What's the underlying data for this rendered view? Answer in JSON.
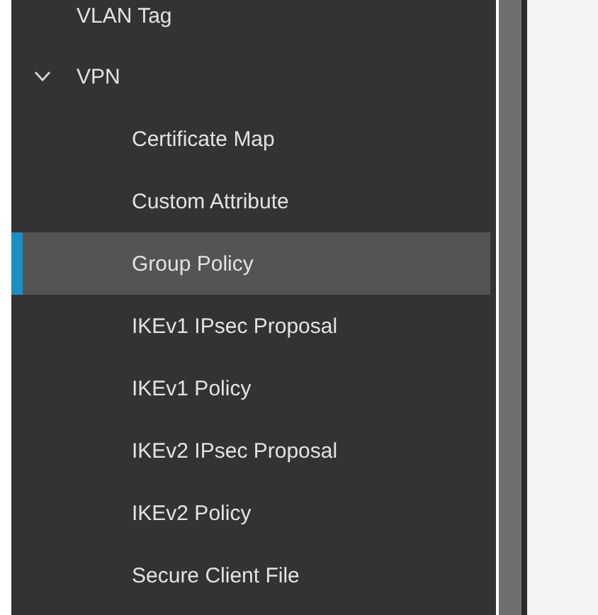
{
  "nav": [
    {
      "label": "VLAN Tag",
      "selected": false
    },
    {
      "label": "VPN",
      "selected": false,
      "expanded": true,
      "children": [
        {
          "label": "Certificate Map",
          "selected": false
        },
        {
          "label": "Custom Attribute",
          "selected": false
        },
        {
          "label": "Group Policy",
          "selected": true
        },
        {
          "label": "IKEv1 IPsec Proposal",
          "selected": false
        },
        {
          "label": "IKEv1 Policy",
          "selected": false
        },
        {
          "label": "IKEv2 IPsec Proposal",
          "selected": false
        },
        {
          "label": "IKEv2 Policy",
          "selected": false
        },
        {
          "label": "Secure Client File",
          "selected": false
        }
      ]
    }
  ]
}
